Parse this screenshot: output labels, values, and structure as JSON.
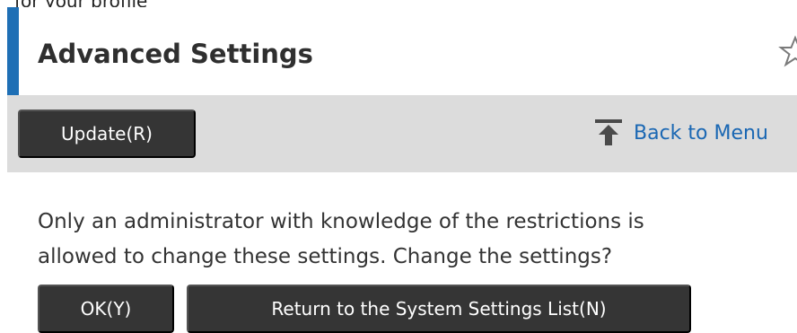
{
  "header": {
    "top_cut_text": "for your profile",
    "title": "Advanced Settings",
    "favorite_icon": "star-outline-icon"
  },
  "toolbar": {
    "update_label": "Update(R)",
    "back_icon": "back-to-top-icon",
    "back_label": "Back to Menu"
  },
  "main": {
    "message_line1": "Only an administrator with knowledge of the restrictions is",
    "message_line2": "allowed to change these settings. Change the settings?",
    "ok_label": "OK(Y)",
    "return_label": "Return to the System Settings List(N)"
  },
  "colors": {
    "accent": "#1e6fb5",
    "button_bg": "#353535",
    "toolbar_bg": "#dcdcdc",
    "link": "#1a67b3"
  }
}
